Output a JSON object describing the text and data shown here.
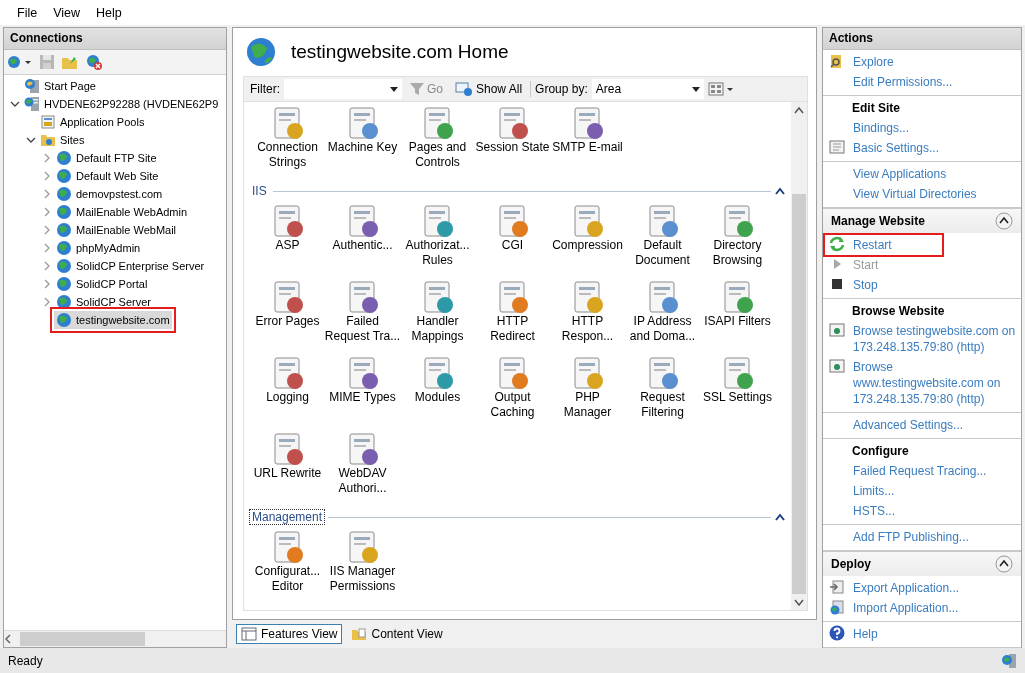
{
  "menu": [
    {
      "label": "File"
    },
    {
      "label": "View"
    },
    {
      "label": "Help"
    }
  ],
  "connections": {
    "title": "Connections",
    "tree": [
      {
        "label": "Start Page",
        "kind": "page",
        "selected": false,
        "highlighted": false
      },
      {
        "label": "HVDENE62P92288 (HVDENE62P9",
        "kind": "server",
        "selected": false,
        "highlighted": false,
        "expanded": true,
        "children": [
          {
            "label": "Application Pools",
            "kind": "pools",
            "selected": false,
            "highlighted": false
          },
          {
            "label": "Sites",
            "kind": "folder",
            "selected": false,
            "highlighted": false,
            "expanded": true,
            "children": [
              {
                "label": "Default FTP Site",
                "kind": "site",
                "selected": false,
                "highlighted": false,
                "expanded": false
              },
              {
                "label": "Default Web Site",
                "kind": "site",
                "selected": false,
                "highlighted": false,
                "expanded": false
              },
              {
                "label": "demovpstest.com",
                "kind": "site",
                "selected": false,
                "highlighted": false,
                "expanded": false
              },
              {
                "label": "MailEnable WebAdmin",
                "kind": "site",
                "selected": false,
                "highlighted": false,
                "expanded": false
              },
              {
                "label": "MailEnable WebMail",
                "kind": "site",
                "selected": false,
                "highlighted": false,
                "expanded": false
              },
              {
                "label": "phpMyAdmin",
                "kind": "site",
                "selected": false,
                "highlighted": false,
                "expanded": false
              },
              {
                "label": "SolidCP Enterprise Server",
                "kind": "site",
                "selected": false,
                "highlighted": false,
                "expanded": false
              },
              {
                "label": "SolidCP Portal",
                "kind": "site",
                "selected": false,
                "highlighted": false,
                "expanded": false
              },
              {
                "label": "SolidCP Server",
                "kind": "site",
                "selected": false,
                "highlighted": false,
                "expanded": false
              },
              {
                "label": "testingwebsite.com",
                "kind": "site",
                "selected": true,
                "highlighted": true
              }
            ]
          }
        ]
      }
    ]
  },
  "home": {
    "title": "testingwebsite.com Home",
    "toolbar": {
      "filter_label": "Filter:",
      "go": "Go",
      "go_disabled": true,
      "show_all": "Show All",
      "group_by_label": "Group by:",
      "group_by_value": "Area"
    },
    "groups": [
      {
        "features": [
          "Connection\nStrings",
          "Machine Key",
          "Pages and\nControls",
          "Session State",
          "SMTP E-mail"
        ]
      },
      {
        "title": "IIS",
        "focused": false,
        "expanded": true,
        "features": [
          "ASP",
          "Authentic...",
          "Authorizat...\nRules",
          "CGI",
          "Compression",
          "Default\nDocument",
          "Directory\nBrowsing",
          "Error Pages",
          "Failed\nRequest Tra...",
          "Handler\nMappings",
          "HTTP\nRedirect",
          "HTTP\nRespon...",
          "IP Address\nand Doma...",
          "ISAPI Filters",
          "Logging",
          "MIME Types",
          "Modules",
          "Output\nCaching",
          "PHP\nManager",
          "Request\nFiltering",
          "SSL Settings",
          "URL Rewrite",
          "WebDAV\nAuthori..."
        ]
      },
      {
        "title": "Management",
        "focused": true,
        "expanded": true,
        "features": [
          "Configurat...\nEditor",
          "IIS Manager\nPermissions"
        ]
      }
    ],
    "view_tabs": [
      {
        "label": "Features View",
        "selected": true
      },
      {
        "label": "Content View",
        "selected": false
      }
    ]
  },
  "actions": {
    "title": "Actions",
    "groups": [
      {
        "items": [
          {
            "label": "Explore",
            "kind": "folder",
            "disabled": false,
            "highlighted": false
          },
          {
            "label": "Edit Permissions...",
            "kind": "plain",
            "disabled": false,
            "highlighted": false
          }
        ]
      },
      {
        "heading": "Edit Site",
        "items": [
          {
            "label": "Bindings...",
            "kind": "plain",
            "disabled": false,
            "highlighted": false
          },
          {
            "label": "Basic Settings...",
            "kind": "settings",
            "disabled": false,
            "highlighted": false
          }
        ]
      },
      {
        "items": [
          {
            "label": "View Applications",
            "kind": "plain",
            "disabled": false,
            "highlighted": false
          },
          {
            "label": "View Virtual Directories",
            "kind": "plain",
            "disabled": false,
            "highlighted": false
          }
        ]
      }
    ]
  },
  "panels": [
    {
      "title": "Manage Website",
      "expanded": true,
      "groups": [
        {
          "items": [
            {
              "label": "Restart",
              "kind": "restart",
              "disabled": false,
              "highlighted": true
            },
            {
              "label": "Start",
              "kind": "start",
              "disabled": true,
              "highlighted": false
            },
            {
              "label": "Stop",
              "kind": "stop",
              "disabled": false,
              "highlighted": false
            }
          ]
        },
        {
          "heading": "Browse Website",
          "items": [
            {
              "label": "Browse testingwebsite.com on 173.248.135.79:80 (http)",
              "kind": "browse",
              "disabled": false,
              "highlighted": false
            },
            {
              "label": "Browse www.testingwebsite.com on 173.248.135.79:80 (http)",
              "kind": "browse",
              "disabled": false,
              "highlighted": false
            }
          ]
        },
        {
          "items": [
            {
              "label": "Advanced Settings...",
              "kind": "plain",
              "disabled": false,
              "highlighted": false
            }
          ]
        },
        {
          "heading": "Configure",
          "items": [
            {
              "label": "Failed Request Tracing...",
              "kind": "plain",
              "disabled": false,
              "highlighted": false
            },
            {
              "label": "Limits...",
              "kind": "plain",
              "disabled": false,
              "highlighted": false
            },
            {
              "label": "HSTS...",
              "kind": "plain",
              "disabled": false,
              "highlighted": false
            }
          ]
        },
        {
          "items": [
            {
              "label": "Add FTP Publishing...",
              "kind": "plain",
              "disabled": false,
              "highlighted": false
            }
          ]
        }
      ]
    },
    {
      "title": "Deploy",
      "expanded": true,
      "groups": [
        {
          "items": [
            {
              "label": "Export Application...",
              "kind": "export",
              "disabled": false,
              "highlighted": false
            },
            {
              "label": "Import Application...",
              "kind": "import",
              "disabled": false,
              "highlighted": false
            }
          ]
        },
        {
          "items": [
            {
              "label": "Help",
              "kind": "help",
              "disabled": false,
              "highlighted": false
            }
          ]
        }
      ]
    }
  ],
  "status_bar": {
    "text": "Ready"
  }
}
